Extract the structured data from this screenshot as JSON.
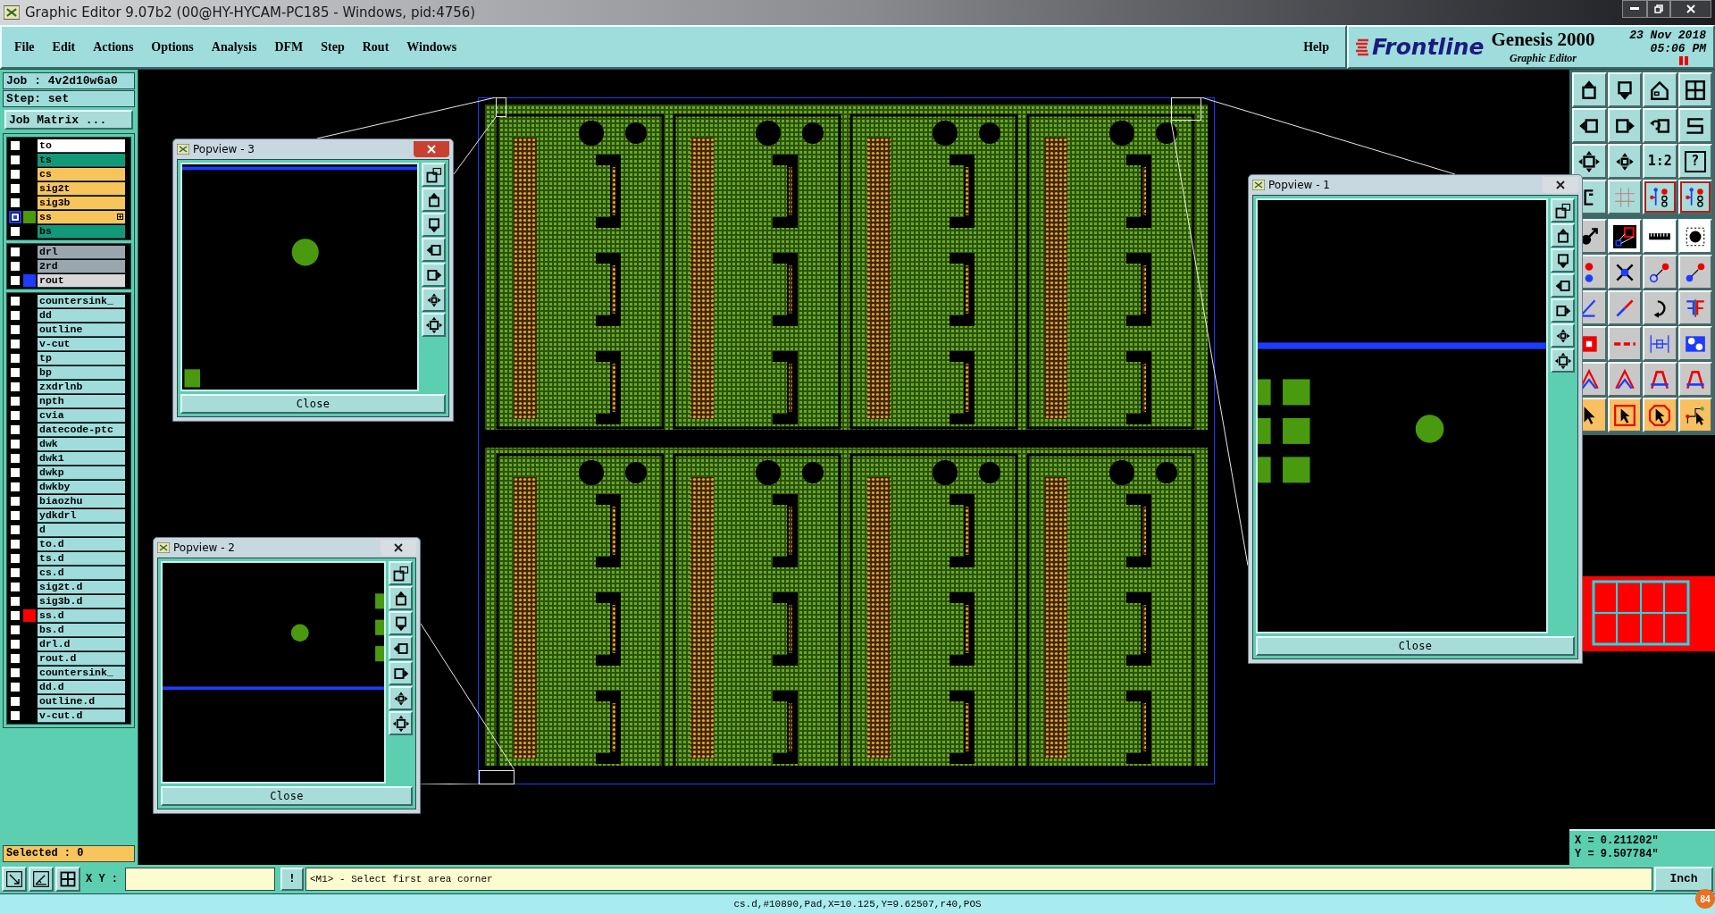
{
  "window": {
    "title": "Graphic Editor 9.07b2 (00@HY-HYCAM-PC185 - Windows, pid:4756)"
  },
  "menu": [
    "File",
    "Edit",
    "Actions",
    "Options",
    "Analysis",
    "DFM",
    "Step",
    "Rout",
    "Windows"
  ],
  "help": "Help",
  "brand": {
    "logo": "Frontline",
    "product": "Genesis 2000",
    "subtitle": "Graphic Editor",
    "date": "23 Nov 2018",
    "time": "05:06 PM"
  },
  "job": {
    "job": "Job : 4v2d10w6a0",
    "step": "Step: set",
    "matrix_button": "Job Matrix ..."
  },
  "layer_groups": [
    {
      "layers": [
        {
          "name": "to",
          "kind": "silk",
          "selected": false
        },
        {
          "name": "ts",
          "kind": "mask",
          "selected": false
        },
        {
          "name": "cs",
          "kind": "signal",
          "selected": false
        },
        {
          "name": "sig2t",
          "kind": "signal",
          "selected": false
        },
        {
          "name": "sig3b",
          "kind": "signal",
          "selected": false
        },
        {
          "name": "ss",
          "kind": "signal",
          "selected": true,
          "color": "#4a9a10"
        },
        {
          "name": "bs",
          "kind": "mask",
          "selected": false
        }
      ]
    },
    {
      "layers": [
        {
          "name": "drl",
          "kind": "drill",
          "selected": false
        },
        {
          "name": "2rd",
          "kind": "drill",
          "selected": false
        },
        {
          "name": "rout",
          "kind": "rout",
          "selected": false,
          "color": "#1e3cff"
        }
      ]
    },
    {
      "layers": [
        {
          "name": "countersink_",
          "kind": "misc",
          "selected": false
        },
        {
          "name": "dd",
          "kind": "misc",
          "selected": false
        },
        {
          "name": "outline",
          "kind": "misc",
          "selected": false
        },
        {
          "name": "v-cut",
          "kind": "misc",
          "selected": false
        },
        {
          "name": "tp",
          "kind": "misc",
          "selected": false
        },
        {
          "name": "bp",
          "kind": "misc",
          "selected": false
        },
        {
          "name": "zxdrlnb",
          "kind": "misc",
          "selected": false
        },
        {
          "name": "npth",
          "kind": "misc",
          "selected": false
        },
        {
          "name": "cvia",
          "kind": "misc",
          "selected": false
        },
        {
          "name": "datecode-ptc",
          "kind": "misc",
          "selected": false
        },
        {
          "name": "dwk",
          "kind": "misc",
          "selected": false
        },
        {
          "name": "dwk1",
          "kind": "misc",
          "selected": false
        },
        {
          "name": "dwkp",
          "kind": "misc",
          "selected": false
        },
        {
          "name": "dwkby",
          "kind": "misc",
          "selected": false
        },
        {
          "name": "biaozhu",
          "kind": "misc",
          "selected": false
        },
        {
          "name": "ydkdrl",
          "kind": "misc",
          "selected": false
        },
        {
          "name": "d",
          "kind": "misc",
          "selected": false
        },
        {
          "name": "to.d",
          "kind": "misc",
          "selected": false
        },
        {
          "name": "ts.d",
          "kind": "misc",
          "selected": false
        },
        {
          "name": "cs.d",
          "kind": "misc",
          "selected": false
        },
        {
          "name": "sig2t.d",
          "kind": "misc",
          "selected": false
        },
        {
          "name": "sig3b.d",
          "kind": "misc",
          "selected": false
        },
        {
          "name": "ss.d",
          "kind": "misc",
          "selected": false,
          "color": "#ff0000"
        },
        {
          "name": "bs.d",
          "kind": "misc",
          "selected": false
        },
        {
          "name": "drl.d",
          "kind": "misc",
          "selected": false
        },
        {
          "name": "rout.d",
          "kind": "misc",
          "selected": false
        },
        {
          "name": "countersink_",
          "kind": "misc",
          "selected": false
        },
        {
          "name": "dd.d",
          "kind": "misc",
          "selected": false
        },
        {
          "name": "outline.d",
          "kind": "misc",
          "selected": false
        },
        {
          "name": "v-cut.d",
          "kind": "misc",
          "selected": false
        }
      ]
    }
  ],
  "selected_count": "Selected : 0",
  "popviews": [
    {
      "title": "Popview - 3",
      "active": true,
      "close": "Close"
    },
    {
      "title": "Popview - 2",
      "active": false,
      "close": "Close"
    },
    {
      "title": "Popview - 1",
      "active": false,
      "close": "Close"
    }
  ],
  "toolbar": {
    "ratio": "1:2",
    "help": "?"
  },
  "coords": {
    "x": "X = 0.211202\"",
    "y": "Y = 9.507784\""
  },
  "command": {
    "xy_label": "X Y :",
    "bang": "!",
    "prompt": "<M1> - Select first area corner",
    "units": "Inch"
  },
  "status": "cs.d,#10890,Pad,X=10.125,Y=9.62507,r40,POS",
  "badge": "84"
}
